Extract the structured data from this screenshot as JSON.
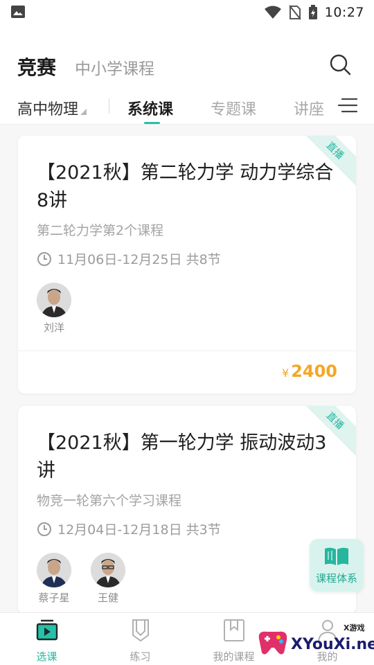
{
  "status_bar": {
    "time": "10:27"
  },
  "header": {
    "title": "竞赛",
    "subtitle": "中小学课程"
  },
  "tabs_bar": {
    "subject": "高中物理",
    "tabs": [
      {
        "label": "系统课",
        "active": true
      },
      {
        "label": "专题课",
        "active": false
      },
      {
        "label": "讲座",
        "active": false
      }
    ]
  },
  "courses": [
    {
      "badge": "直播",
      "title": "【2021秋】第二轮力学 动力学综合8讲",
      "description": "第二轮力学第2个课程",
      "schedule": "11月06日-12月25日  共8节",
      "teachers": [
        "刘洋"
      ],
      "currency": "¥",
      "price": "2400"
    },
    {
      "badge": "直播",
      "title": "【2021秋】第一轮力学 振动波动3讲",
      "description": "物竞一轮第六个学习课程",
      "schedule": "12月04日-12月18日  共3节",
      "teachers": [
        "蔡子星",
        "王健"
      ]
    }
  ],
  "fab": {
    "label": "课程体系",
    "icon": "book-icon"
  },
  "bottom_nav": [
    {
      "label": "选课",
      "icon": "play-video-icon",
      "active": true
    },
    {
      "label": "练习",
      "icon": "pencil-icon",
      "active": false
    },
    {
      "label": "我的课程",
      "icon": "bookmark-book-icon",
      "active": false
    },
    {
      "label": "我的",
      "icon": "person-icon",
      "active": false
    }
  ],
  "watermark": {
    "small": "X游戏",
    "text": "XYouXi.net"
  },
  "colors": {
    "accent": "#27c0a8",
    "price": "#f5a623"
  }
}
